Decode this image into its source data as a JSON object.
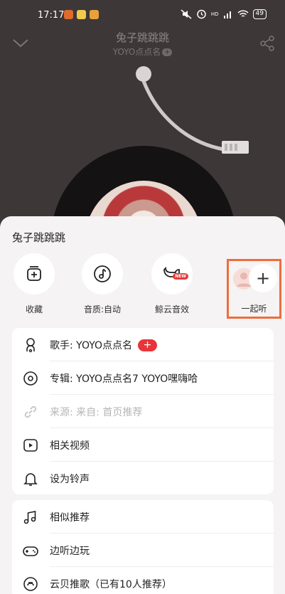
{
  "status_bar": {
    "time": "17:17",
    "network_label": "HD",
    "battery": "49"
  },
  "player": {
    "song_title": "兔子跳跳跳",
    "artist": "YOYO点点名",
    "artist_plus": "+"
  },
  "sheet": {
    "title": "兔子跳跳跳",
    "actions": [
      {
        "label": "收藏",
        "icon": "add-to-playlist-icon"
      },
      {
        "label": "音质:自动",
        "icon": "music-quality-icon"
      },
      {
        "label": "鲸云音效",
        "icon": "whale-effect-icon",
        "badge": "NEW"
      },
      {
        "label": "一起听",
        "icon": "add-icon",
        "plus": "+"
      }
    ],
    "card1": [
      {
        "label": "歌手: YOYO点点名",
        "icon": "singer-icon",
        "follow": "+"
      },
      {
        "label": "专辑: YOYO点点名7 YOYO嘿嗨哈",
        "icon": "album-icon"
      },
      {
        "label": "来源: 来自: 首页推荐",
        "icon": "link-icon",
        "muted": true
      },
      {
        "label": "相关视频",
        "icon": "video-icon"
      },
      {
        "label": "设为铃声",
        "icon": "bell-icon"
      }
    ],
    "card2": [
      {
        "label": "相似推荐",
        "icon": "similar-music-icon"
      },
      {
        "label": "边听边玩",
        "icon": "gamepad-icon"
      },
      {
        "label": "云贝推歌（已有10人推荐）",
        "icon": "cloud-coin-icon"
      }
    ]
  },
  "colors": {
    "accent_red": "#e8353a",
    "highlight_orange": "#ee6d3c"
  }
}
